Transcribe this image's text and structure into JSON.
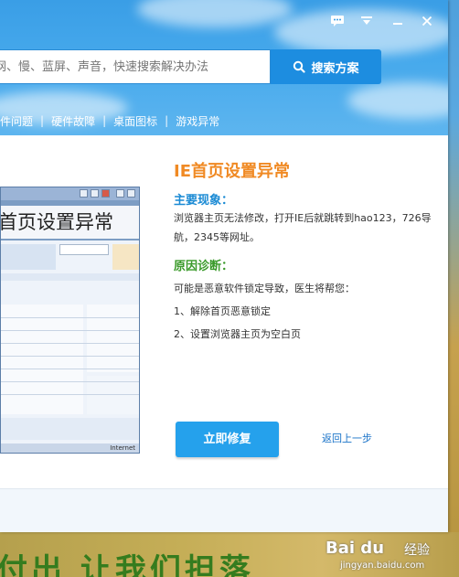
{
  "colors": {
    "header_blue": "#3a9ee6",
    "search_button": "#1d8de0",
    "issue_title_orange": "#f08a24",
    "section_blue": "#1a8ad4",
    "section_green": "#3a9a2a",
    "fix_button": "#25a1ec",
    "link_blue": "#1a73c8"
  },
  "titlebar": {
    "icons": [
      "chat-bubble-icon",
      "menu-icon",
      "minimize-icon",
      "close-icon"
    ]
  },
  "search": {
    "placeholder": "网、慢、蓝屏、声音，快速搜索解决办法",
    "button_label": "搜索方案",
    "button_icon": "search-icon"
  },
  "nav": {
    "items": [
      "件问题",
      "硬件故障",
      "桌面图标",
      "游戏异常"
    ]
  },
  "thumbnail": {
    "title": "首页设置异常",
    "status_text": "Internet"
  },
  "issue": {
    "title": "IE首页设置异常",
    "symptom_heading": "主要现象：",
    "symptom_text": "浏览器主页无法修改，打开IE后就跳转到hao123，726导航，2345等网址。",
    "diagnosis_heading": "原因诊断：",
    "diagnosis_intro": "可能是恶意软件锁定导致，医生将帮您：",
    "steps": [
      "1、解除首页恶意锁定",
      "2、设置浏览器主页为空白页"
    ]
  },
  "actions": {
    "fix_label": "立即修复",
    "back_label": "返回上一步"
  },
  "background": {
    "banner_text": "付出 让我们担落"
  },
  "watermark": {
    "logo": "Bai du",
    "suffix": "经验",
    "url": "jingyan.baidu.com"
  }
}
